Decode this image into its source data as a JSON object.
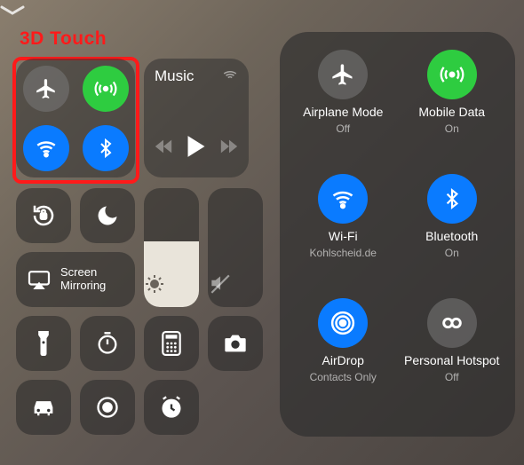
{
  "annotation": {
    "title": "3D Touch"
  },
  "connectivity": {
    "airplane": {
      "name": "Airplane Mode",
      "status": "Off",
      "color_off": "c-gray"
    },
    "mobile": {
      "name": "Mobile Data",
      "status": "On",
      "color": "c-green"
    },
    "wifi": {
      "name": "Wi-Fi",
      "status": "Kohlscheid.de",
      "color": "c-blue"
    },
    "bluetooth": {
      "name": "Bluetooth",
      "status": "On",
      "color": "c-blue"
    },
    "airdrop": {
      "name": "AirDrop",
      "status": "Contacts Only",
      "color": "c-blue"
    },
    "hotspot": {
      "name": "Personal Hotspot",
      "status": "Off",
      "color_off": "c-gray"
    }
  },
  "music": {
    "title": "Music"
  },
  "screen_mirroring": {
    "label": "Screen\nMirroring"
  },
  "brightness_fill_pct": 55,
  "volume_fill_pct": 0,
  "icons": {
    "airplane": "airplane-icon",
    "antenna": "antenna-icon",
    "wifi": "wifi-icon",
    "bluetooth": "bluetooth-icon",
    "airdrop": "airdrop-icon",
    "hotspot": "hotspot-icon",
    "lock_rotation": "rotation-lock-icon",
    "moon": "do-not-disturb-icon",
    "airplay": "airplay-icon",
    "sun": "brightness-icon",
    "speaker_mute": "mute-icon",
    "flashlight": "flashlight-icon",
    "timer": "timer-icon",
    "calculator": "calculator-icon",
    "camera": "camera-icon",
    "car": "car-icon",
    "record": "screen-record-icon",
    "alarm": "alarm-icon",
    "play": "play-icon",
    "prev": "previous-icon",
    "next": "next-icon",
    "chevron": "chevron-down-icon"
  }
}
